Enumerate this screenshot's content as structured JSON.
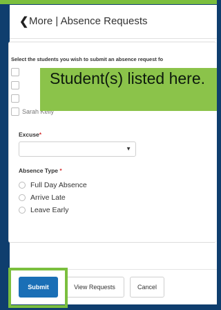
{
  "header": {
    "back_icon": "chevron-left-icon",
    "title": "More | Absence Requests"
  },
  "form": {
    "instruction": "Select the students you wish to submit an absence request fo",
    "partial_student_name": "Sarah Kelly",
    "callout_text": "Student(s) listed here.",
    "excuse_label": "Excuse",
    "excuse_required_mark": "*",
    "excuse_value": "",
    "absence_type_label": "Absence Type",
    "absence_type_required_mark": "*",
    "absence_options": [
      "Full Day Absence",
      "Arrive Late",
      "Leave Early"
    ]
  },
  "footer": {
    "submit_label": "Submit",
    "view_requests_label": "View Requests",
    "cancel_label": "Cancel"
  },
  "colors": {
    "accent": "#1a6fb6",
    "highlight_green": "#7bbf3e",
    "callout_green": "#8bc34a",
    "background": "#0f3e6e"
  }
}
